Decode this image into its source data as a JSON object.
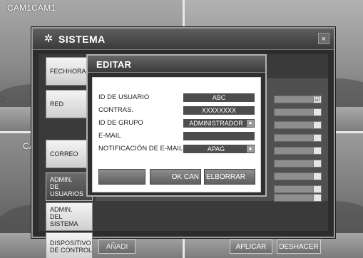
{
  "camera": {
    "top_label": "CAM1CAM1",
    "bottom_label": "CA"
  },
  "window": {
    "title": "SISTEMA",
    "gear_icon": "gear-icon",
    "close_icon": "close-icon",
    "close_glyph": "×",
    "nav": [
      {
        "label": "FECHHORA"
      },
      {
        "label": "RED"
      },
      {
        "label": "CORREO"
      },
      {
        "label": "ADMIN.\nDE USUARIOS"
      },
      {
        "label": "ADMIN.\nDEL SISTEMA"
      },
      {
        "label": "DISPOSITIVO\nDE CONTROL"
      }
    ],
    "active_nav_index": 3,
    "first_row_checked": "☑",
    "bottom": {
      "add_label": "AÑADI",
      "apply_label": "APLICAR",
      "undo_label": "DESHACER"
    }
  },
  "dialog": {
    "title": "EDITAR",
    "fields": {
      "user_id": {
        "label": "ID DE USUARIO",
        "value": "ABC"
      },
      "password": {
        "label": "CONTRAS.",
        "value": "XXXXXXXX"
      },
      "group_id": {
        "label": "ID DE GRUPO",
        "value": "ADMINISTRADOR"
      },
      "email": {
        "label": "E-MAIL",
        "value": ""
      },
      "email_notification": {
        "label": "NOTIFICACIÓN DE E-MAIL",
        "value": "APAG"
      }
    },
    "buttons": {
      "blank_label": "",
      "ok_cancel_label": "OK CAN",
      "delete_label": "ELBORRAR"
    },
    "dropdown_glyph": "▲▼"
  },
  "annotations": {
    "left_arrow": ">"
  },
  "colors": {
    "window_bg": "#2c2c2c",
    "dialog_field_bg": "#4d4d4d",
    "nav_active_bg": "#454545"
  }
}
